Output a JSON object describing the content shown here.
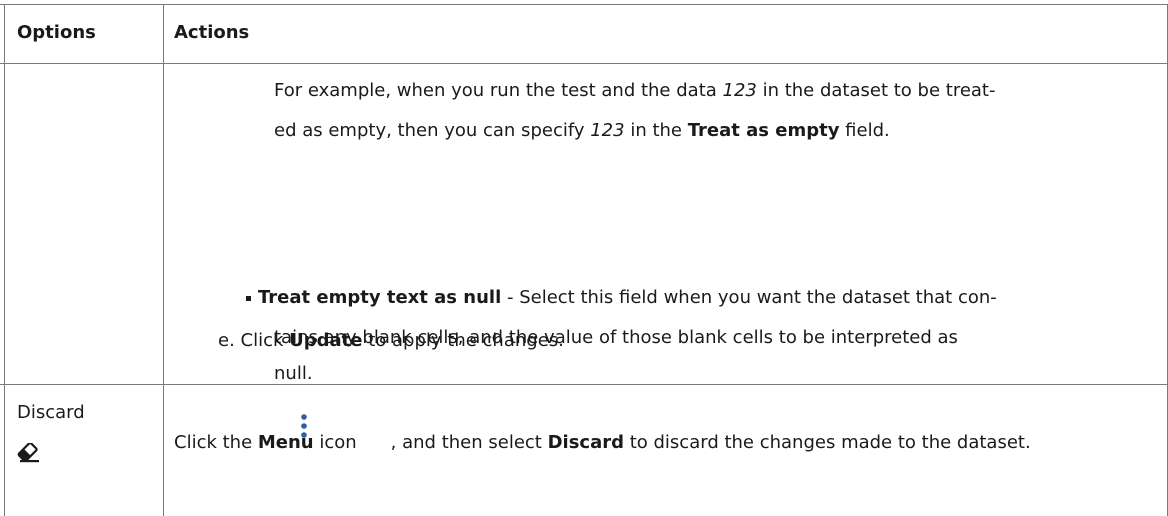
{
  "table": {
    "headers": {
      "options": "Options",
      "actions": "Actions"
    },
    "row1": {
      "example": {
        "l1_a": "For example, when you run the test and the data ",
        "l1_b": "123",
        "l1_c": " in the dataset to be treat-",
        "l2_a": "ed as empty, then you can specify ",
        "l2_b": "123",
        "l2_c": " in the ",
        "l2_d": "Treat as empty",
        "l2_e": " field."
      },
      "bullet": {
        "l1_a": "Treat empty text as null",
        "l1_b": " - Select this field when you want the dataset that con-",
        "l2": "tains any blank cells, and the value of those blank cells to be interpreted as",
        "l3": "null."
      },
      "step_e": {
        "a": "e. Click ",
        "b": "Update",
        "c": " to apply the changes."
      }
    },
    "row2": {
      "option_label": "Discard",
      "option_icon": "eraser-icon",
      "action": {
        "a": "Click the ",
        "b": "Menu",
        "c": " icon",
        "menu_icon": "vertical-ellipsis-icon",
        "d": ", and then select ",
        "e": "Discard",
        "f": " to discard the changes made to the dataset."
      }
    }
  },
  "colors": {
    "border": "#7a7a7a",
    "text": "#1a1a1a",
    "menu_icon": "#2e5fa5"
  }
}
